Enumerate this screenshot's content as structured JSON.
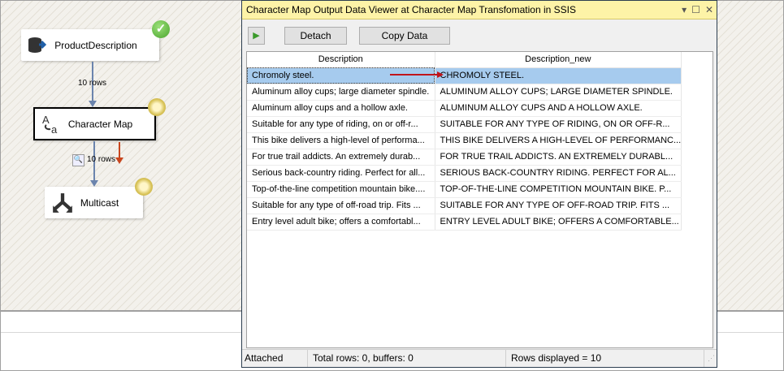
{
  "canvas": {
    "nodes": [
      {
        "label": "ProductDescription",
        "icon": "database-source-icon",
        "status": "success"
      },
      {
        "label": "Character Map",
        "icon": "character-map-icon",
        "status": "running"
      },
      {
        "label": "Multicast",
        "icon": "multicast-icon",
        "status": "running"
      }
    ],
    "paths": [
      {
        "label": "10 rows"
      },
      {
        "label": "10 rows"
      }
    ]
  },
  "viewer": {
    "title": "Character Map Output Data Viewer at Character Map Transfomation in SSIS",
    "toolbar": {
      "detach": "Detach",
      "copy": "Copy Data"
    },
    "columns": [
      "Description",
      "Description_new"
    ],
    "rows": [
      [
        "Chromoly steel.",
        "CHROMOLY STEEL."
      ],
      [
        "Aluminum alloy cups; large diameter spindle.",
        "ALUMINUM ALLOY CUPS; LARGE DIAMETER SPINDLE."
      ],
      [
        "Aluminum alloy cups and a hollow axle.",
        "ALUMINUM ALLOY CUPS AND A HOLLOW AXLE."
      ],
      [
        "Suitable for any type of riding, on or off-r...",
        "SUITABLE FOR ANY TYPE OF RIDING, ON OR OFF-R..."
      ],
      [
        "This bike delivers a high-level of performa...",
        "THIS BIKE DELIVERS A HIGH-LEVEL OF PERFORMANC..."
      ],
      [
        "For true trail addicts.  An extremely durab...",
        "FOR TRUE TRAIL ADDICTS.  AN EXTREMELY DURABL..."
      ],
      [
        "Serious back-country riding. Perfect for all...",
        "SERIOUS BACK-COUNTRY RIDING. PERFECT FOR AL..."
      ],
      [
        "Top-of-the-line competition mountain bike....",
        "TOP-OF-THE-LINE COMPETITION MOUNTAIN BIKE. P..."
      ],
      [
        "Suitable for any type of off-road trip. Fits ...",
        "SUITABLE FOR ANY TYPE OF OFF-ROAD TRIP. FITS ..."
      ],
      [
        "Entry level adult bike; offers a comfortabl...",
        "ENTRY LEVEL ADULT BIKE; OFFERS A COMFORTABLE..."
      ]
    ],
    "status": {
      "state": "Attached",
      "totals": "Total rows: 0, buffers: 0",
      "displayed": "Rows displayed = 10"
    }
  }
}
